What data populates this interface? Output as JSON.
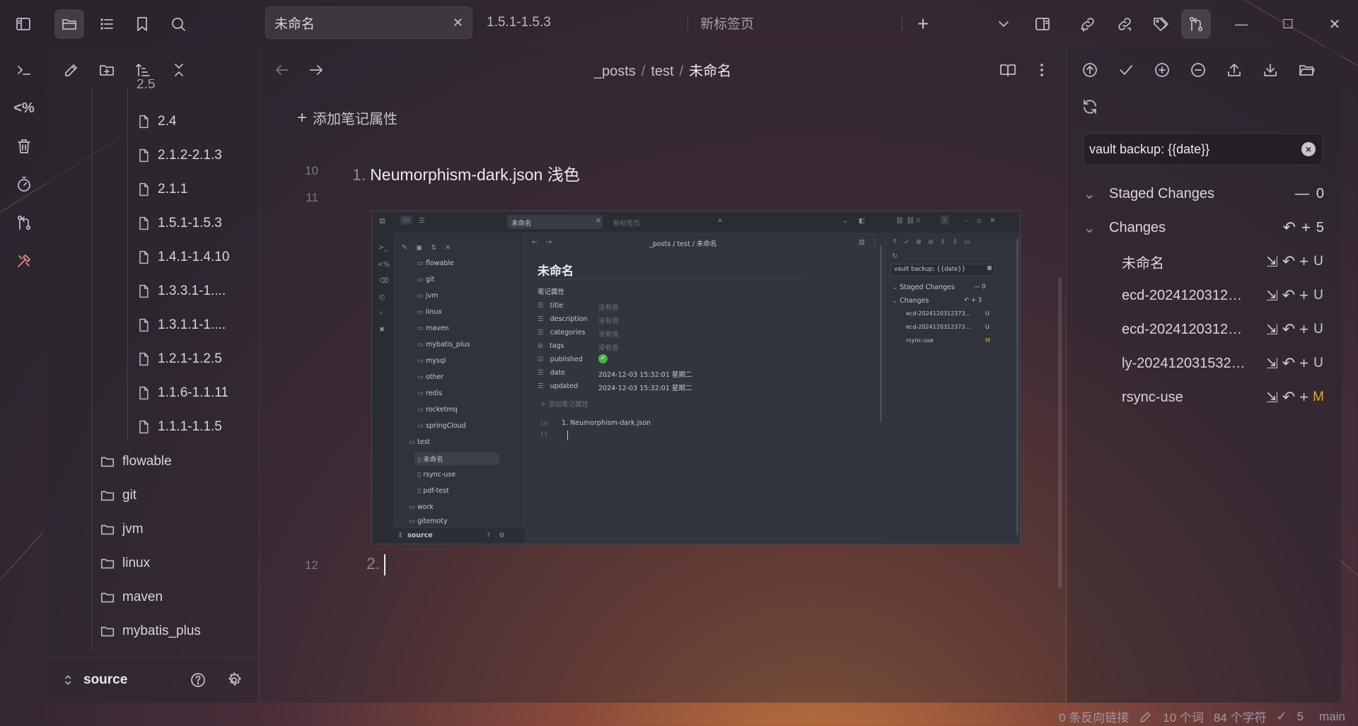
{
  "tabs": {
    "active": {
      "label": "未命名",
      "close": "✕"
    },
    "second": {
      "label": "1.5.1-1.5.3"
    },
    "third": {
      "label": "新标签页"
    },
    "new_tab": "+"
  },
  "window": {
    "minimize": "—",
    "maximize": "☐",
    "close": "✕"
  },
  "breadcrumb": {
    "p1": "_posts",
    "sep": "/",
    "p2": "test",
    "p3": "未命名"
  },
  "tree": {
    "partial_top": "2.5",
    "files": [
      "2.4",
      "2.1.2-2.1.3",
      "2.1.1",
      "1.5.1-1.5.3",
      "1.4.1-1.4.10",
      "1.3.3.1-1....",
      "1.3.1.1-1....",
      "1.2.1-1.2.5",
      "1.1.6-1.1.11",
      "1.1.1-1.1.5"
    ],
    "folders": [
      "flowable",
      "git",
      "jvm",
      "linux",
      "maven",
      "mybatis_plus"
    ]
  },
  "vault": {
    "name": "source"
  },
  "editor": {
    "add_property": "添加笔记属性",
    "line10": "10",
    "line11": "11",
    "line12": "12",
    "item1_num": "1.",
    "item1_text": "Neumorphism-dark.json  浅色",
    "item2_num": "2."
  },
  "embedded": {
    "tab_active": "未命名",
    "tab_new": "新标签页",
    "breadcrumb": "_posts / test / 未命名",
    "title": "未命名",
    "props_header": "笔记属性",
    "props": [
      {
        "icon": "☰",
        "key": "title",
        "value": "没有值"
      },
      {
        "icon": "☰",
        "key": "description",
        "value": "没有值"
      },
      {
        "icon": "☰",
        "key": "categories",
        "value": "没有值"
      },
      {
        "icon": "⊘",
        "key": "tags",
        "value": "没有值"
      },
      {
        "icon": "☑",
        "key": "published",
        "value": "✓"
      },
      {
        "icon": "☰",
        "key": "date",
        "value": "2024-12-03 15:32:01 星期二"
      },
      {
        "icon": "☰",
        "key": "updated",
        "value": "2024-12-03 15:32:01 星期二"
      }
    ],
    "add_prop": "+ 添加笔记属性",
    "list_num10": "10",
    "list_num11": "11",
    "list_item": "1.  Neumorphism-dark.json",
    "tree": [
      "flowable",
      "git",
      "jvm",
      "linux",
      "maven",
      "mybatis_plus",
      "mysql",
      "other",
      "redis",
      "rocketmq",
      "springCloud"
    ],
    "tree_test": "test",
    "tree_test_children": [
      "未命名",
      "rsync-use",
      "pdf-test"
    ],
    "tree_more": [
      "work",
      "gitemoty"
    ],
    "vault": "source",
    "commit_msg": "vault backup: {{date}}",
    "staged": "Staged Changes",
    "staged_count": "— 0",
    "changes": "Changes",
    "changes_count": "↶ + 3",
    "files": [
      {
        "name": "ecd-2024120312373...",
        "st": "U"
      },
      {
        "name": "ecd-2024120312373...",
        "st": "U"
      },
      {
        "name": "rsync-use",
        "st": "M"
      }
    ]
  },
  "git": {
    "commit_message": "vault backup: {{date}}",
    "staged_label": "Staged Changes",
    "staged_count": "0",
    "changes_label": "Changes",
    "changes_count": "5",
    "files": [
      {
        "name": "未命名",
        "status": "U"
      },
      {
        "name": "ecd-202412031237...",
        "status": "U"
      },
      {
        "name": "ecd-202412031237...",
        "status": "U"
      },
      {
        "name": "ly-2024120315322...",
        "status": "U"
      },
      {
        "name": "rsync-use",
        "status": "M"
      }
    ]
  },
  "status": {
    "backlinks": "0 条反向链接",
    "words": "10 个词",
    "chars": "84 个字符",
    "sync_count": "5",
    "branch": "main"
  },
  "colors": {
    "accent_modified": "#e8a435",
    "checkbox_green": "#4caf50"
  }
}
